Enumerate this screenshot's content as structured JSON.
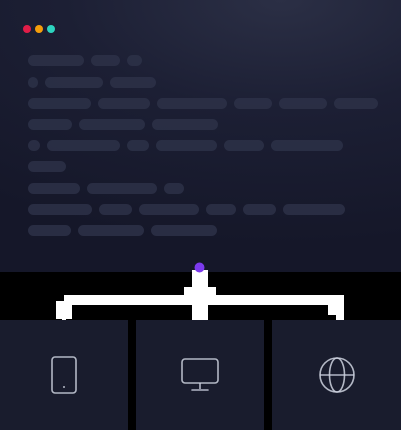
{
  "window": {
    "traffic_lights": {
      "close_color": "#e11d48",
      "minimize_color": "#f59e0b",
      "maximize_color": "#2dd4bf"
    }
  },
  "diagram": {
    "hub_color": "#7c3aed",
    "line_color": "#ffffff"
  },
  "devices": [
    {
      "name": "tablet",
      "icon": "tablet-icon"
    },
    {
      "name": "desktop",
      "icon": "monitor-icon"
    },
    {
      "name": "web",
      "icon": "globe-icon"
    }
  ]
}
